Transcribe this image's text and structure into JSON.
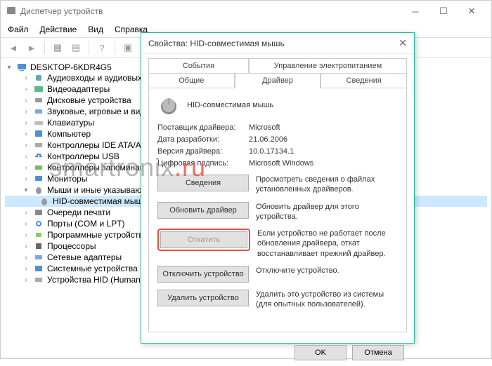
{
  "window": {
    "title": "Диспетчер устройств",
    "menus": {
      "file": "Файл",
      "action": "Действие",
      "view": "Вид",
      "help": "Справка"
    }
  },
  "tree": {
    "root": "DESKTOP-6KDR4G5",
    "items": [
      "Аудиовходы и аудиовыходы",
      "Видеоадаптеры",
      "Дисковые устройства",
      "Звуковые, игровые и видеоустройства",
      "Клавиатуры",
      "Компьютер",
      "Контроллеры IDE ATA/ATAPI",
      "Контроллеры USB",
      "Контроллеры запоминающих устройств",
      "Мониторы",
      "Мыши и иные указывающие устройства"
    ],
    "mouse_child": "HID-совместимая мышь",
    "items2": [
      "Очереди печати",
      "Порты (COM и LPT)",
      "Программные устройства",
      "Процессоры",
      "Сетевые адаптеры",
      "Системные устройства",
      "Устройства HID (Human Interface Devices)"
    ]
  },
  "dialog": {
    "title": "Свойства: HID-совместимая мышь",
    "tabs": {
      "events": "События",
      "power": "Управление электропитанием",
      "general": "Общие",
      "driver": "Драйвер",
      "details": "Сведения"
    },
    "device_name": "HID-совместимая мышь",
    "labels": {
      "provider": "Поставщик драйвера:",
      "date": "Дата разработки:",
      "version": "Версия драйвера:",
      "signer": "Цифровая подпись:"
    },
    "values": {
      "provider": "Microsoft",
      "date": "21.06.2006",
      "version": "10.0.17134.1",
      "signer": "Microsoft Windows"
    },
    "buttons": {
      "details": "Сведения",
      "update": "Обновить драйвер",
      "rollback": "Откатить",
      "disable": "Отключить устройство",
      "uninstall": "Удалить устройство"
    },
    "descriptions": {
      "details": "Просмотреть сведения о файлах установленных драйверов.",
      "update": "Обновить драйвер для этого устройства.",
      "rollback": "Если устройство не работает после обновления драйвера, откат восстанавливает прежний драйвер.",
      "disable": "Отключите устройство.",
      "uninstall": "Удалить это устройство из системы (для опытных пользователей)."
    },
    "ok": "OK",
    "cancel": "Отмена"
  },
  "watermark": {
    "part1": "smartronix",
    "part2": ".ru"
  }
}
